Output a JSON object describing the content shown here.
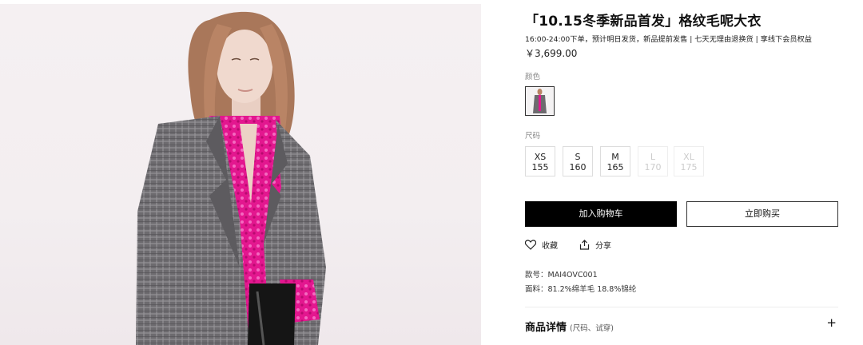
{
  "product": {
    "title": "「10.15冬季新品首发」格纹毛呢大衣",
    "promo": "16:00-24:00下单，预计明日发货，新品提前发售 | 七天无理由退换货 | 享线下会员权益",
    "price": "￥3,699.00",
    "color_label": "颜色",
    "size_label": "尺码",
    "sizes": [
      {
        "name": "XS",
        "value": "155",
        "available": true
      },
      {
        "name": "S",
        "value": "160",
        "available": true
      },
      {
        "name": "M",
        "value": "165",
        "available": true
      },
      {
        "name": "L",
        "value": "170",
        "available": false
      },
      {
        "name": "XL",
        "value": "175",
        "available": false
      }
    ],
    "add_to_cart": "加入购物车",
    "buy_now": "立即购买",
    "favorite": "收藏",
    "share": "分享",
    "style_no": "款号：MAI4OVC001",
    "fabric": "面料：81.2%绵羊毛 18.8%锦纶",
    "detail_title": "商品详情",
    "detail_sub": "(尺码、试穿)",
    "expand": "+"
  },
  "colors": {
    "coat": "#6b6a6d",
    "shirt": "#e0198e",
    "background": "#f4eff1",
    "primary_button": "#000000"
  }
}
